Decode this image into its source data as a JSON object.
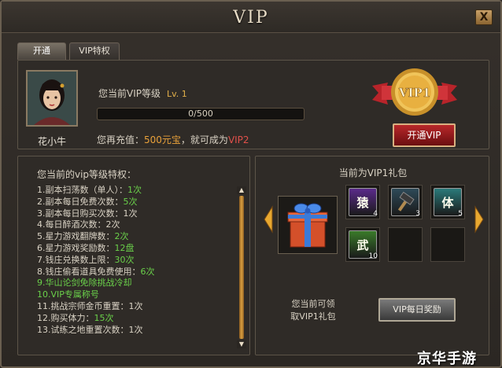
{
  "window": {
    "title": "VIP",
    "close_label": "X"
  },
  "tabs": [
    {
      "label": "开通",
      "active": true
    },
    {
      "label": "VIP特权",
      "active": false
    }
  ],
  "player": {
    "name": "花小牛",
    "vip_level_label": "您当前VIP等级",
    "vip_level_value": "Lv. 1",
    "exp_text": "0/500",
    "exp_progress": 0,
    "recharge_prefix": "您再充值：",
    "recharge_amount": "500元宝",
    "recharge_middle": "，就可成为",
    "recharge_target": "VIP2"
  },
  "medal": {
    "text": "VIP1"
  },
  "open_vip_button": "开通VIP",
  "privileges": {
    "title": "您当前的vip等级特权：",
    "items": [
      {
        "text": "1.副本扫荡数（单人）：",
        "value": "1次",
        "green": false
      },
      {
        "text": "2.副本每日免费次数：",
        "value": "5次",
        "green": false
      },
      {
        "text": "3.副本每日购买次数：1次",
        "value": "",
        "green": false
      },
      {
        "text": "4.每日醉酒次数：2次",
        "value": "",
        "green": false
      },
      {
        "text": "5.星力游戏翻牌数：",
        "value": "2次",
        "green": false
      },
      {
        "text": "6.星力游戏奖励数：",
        "value": "12盘",
        "green": false
      },
      {
        "text": "7.钱庄兑换数上限：",
        "value": "30次",
        "green": false
      },
      {
        "text": "8.钱庄偷看道具免费使用：",
        "value": "6次",
        "green": false
      },
      {
        "text": "9.华山论剑免除挑战冷却",
        "value": "",
        "green": true
      },
      {
        "text": "10.VIP专属称号",
        "value": "",
        "green": true
      },
      {
        "text": "11.挑战宗师金币重置：1次",
        "value": "",
        "green": false
      },
      {
        "text": "12.购买体力：",
        "value": "15次",
        "green": false
      },
      {
        "text": "13.试练之地重置次数：1次",
        "value": "",
        "green": false
      }
    ]
  },
  "gift_pack": {
    "title": "当前为VIP1礼包",
    "items": [
      {
        "glyph": "猿",
        "count": "4",
        "bg": "#5a2a8a"
      },
      {
        "glyph": "",
        "count": "3",
        "bg": "#2e4a58"
      },
      {
        "glyph": "体",
        "count": "5",
        "bg": "#2a7a7a"
      },
      {
        "glyph": "武",
        "count": "10",
        "bg": "#3a7a2a"
      },
      {
        "glyph": "",
        "count": "",
        "bg": ""
      },
      {
        "glyph": "",
        "count": "",
        "bg": ""
      }
    ],
    "claim_text_line1": "您当前可领",
    "claim_text_line2": "取VIP1礼包",
    "daily_button": "VIP每日奖励"
  },
  "colors": {
    "accent": "#e9a13a",
    "highlight": "#6ad04a",
    "warn": "#e0504a"
  },
  "watermark": "京华手游"
}
